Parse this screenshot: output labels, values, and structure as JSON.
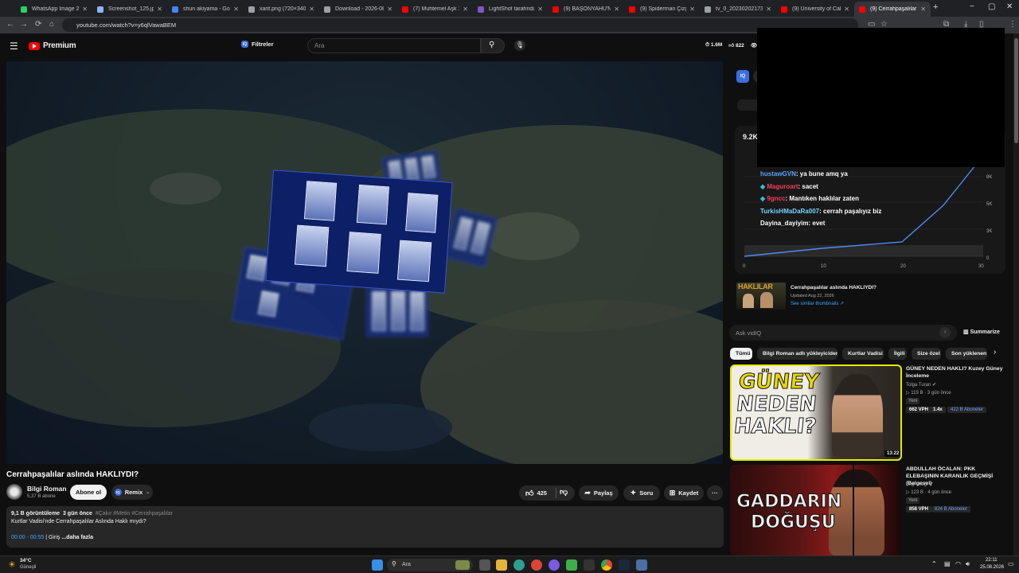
{
  "tabs": [
    {
      "label": "WhatsApp Image 2026",
      "color": "#25d366"
    },
    {
      "label": "Screenshot_125.jpg (6",
      "color": "#8ab4f8"
    },
    {
      "label": "shun akiyama - Googl",
      "color": "#4285f4"
    },
    {
      "label": "xarit.png (720×340)",
      "color": "#9aa0a6"
    },
    {
      "label": "Download - 2026-08-",
      "color": "#9aa0a6"
    },
    {
      "label": "(7) Muhtemel Aşk 11. B",
      "color": "#ff0000"
    },
    {
      "label": "LightShot tarafından B",
      "color": "#7e57c2"
    },
    {
      "label": "(9) BAŞONYAHU'NUN",
      "color": "#ff0000"
    },
    {
      "label": "(9) Spiderman Çizgi Fil",
      "color": "#ff0000"
    },
    {
      "label": "tv_0_20230202173857",
      "color": "#9aa0a6"
    },
    {
      "label": "(9) University of Califo",
      "color": "#ff0000"
    },
    {
      "label": "(9) Cerrahpaşalılar asl",
      "color": "#ff0000"
    }
  ],
  "address": {
    "url": "youtube.com/watch?v=y6qlVawaBEM"
  },
  "header": {
    "brand": "Premium",
    "filter_label": "Filtreler",
    "search_placeholder": "Ara",
    "stats": [
      "1.6M",
      "822",
      "4"
    ]
  },
  "video": {
    "title": "Cerrahpaşalılar aslında HAKLIYDI?",
    "channel": "Bilgi Roman",
    "subscribers": "5,37 B abone",
    "subscribe_label": "Abone ol",
    "remix_label": "Remix",
    "likes": "425",
    "share_label": "Paylaş",
    "ask_label": "Soru",
    "save_label": "Kaydet"
  },
  "description": {
    "views": "9,1 B görüntüleme",
    "age": "3 gün önce",
    "hashtags": "#Çakır #Metin #Cerrahpaşalılar",
    "text": "Kurtlar Vadisi'nde Cerrahpaşalılar Aslında Haklı mıydı?",
    "chapter_time": "00:00 - 00:55",
    "chapter_title": "| Giriş",
    "more_label": "...daha fazla"
  },
  "vidiq": {
    "badge": "IQ",
    "views_stat": "9.2K",
    "chart": {
      "y_ticks": [
        "8K",
        "5K",
        "3K",
        "0"
      ],
      "x_ticks": [
        "0",
        "10",
        "20",
        "30"
      ]
    },
    "thumb_title": "Cerrahpaşalılar aslında HAKLIYDI?",
    "thumb_updated": "Updated Aug 22, 2026",
    "thumb_link": "See similar thumbnails ↗",
    "thumb_label": "HAKLILAR",
    "ask_placeholder": "Ask vidIQ",
    "summarize_label": "Summarize"
  },
  "chat": [
    {
      "user": "hustawGVN",
      "msg": ": ya bune amq ya",
      "color": "#5ea2ff"
    },
    {
      "user": "Maguroart",
      "msg": ": sacet",
      "color": "#ff3b5c"
    },
    {
      "user": "9gncc",
      "msg": ": Mantıken haklılar zaten",
      "color": "#ff3b5c"
    },
    {
      "user": "TurkisHMaDaRa007",
      "msg": ": cerrah paşalıyız biz",
      "color": "#79d2ff"
    },
    {
      "user": "Dayina_dayiyim",
      "msg": ": evet",
      "color": "#ffffff"
    }
  ],
  "chips": [
    "Tümü",
    "Bilgi Roman adlı yükleyiciden",
    "Kurtlar Vadisi",
    "İlgili",
    "Size özel",
    "Son yüklenen"
  ],
  "recommendations": [
    {
      "title": "GÜNEY NEDEN HAKLI? Kuzey Güney İnceleme",
      "channel": "Tolga Turan",
      "views": "119 B",
      "age": "3 gün önce",
      "badge": "Yeni",
      "vph": "662 VPH",
      "mult": "1.4x",
      "subs": "422 B Aboneler",
      "duration": "13:22",
      "thumb_lines": [
        "GÜNEY",
        "NEDEN",
        "HAKLI?"
      ]
    },
    {
      "title": "ABDULLAH ÖCALAN: PKK ELEBAŞININ KARANLIK GEÇMİŞİ (Belgesel)",
      "channel": "Bilgi Otağı",
      "views": "123 B",
      "age": "4 gün önce",
      "badge": "Yeni",
      "vph": "858 VPH",
      "subs": "824 B Aboneler",
      "thumb_lines": [
        "GADDARIN",
        "DOĞUŞU"
      ]
    }
  ],
  "taskbar": {
    "weather_temp": "34°C",
    "weather_desc": "Güneşli",
    "search_label": "Ara",
    "time": "22:11",
    "date": "25.08.2026"
  }
}
